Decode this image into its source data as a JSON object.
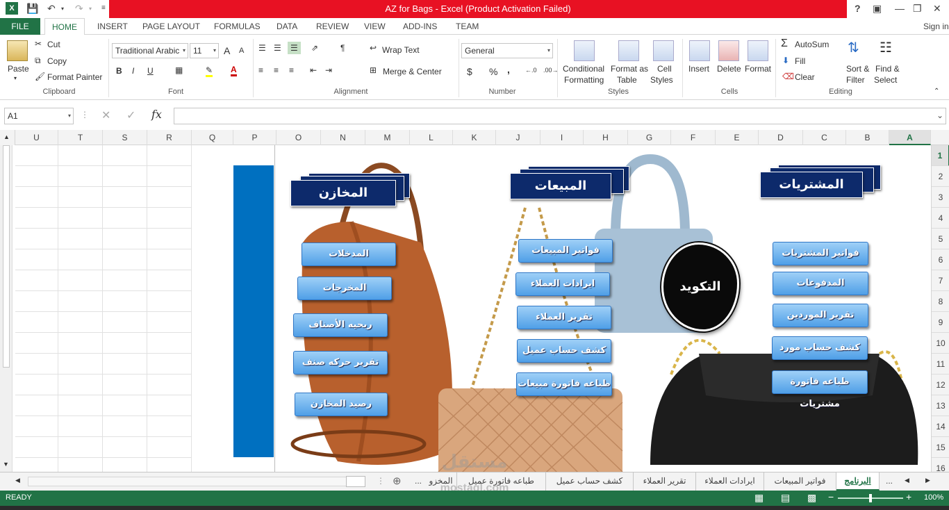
{
  "window": {
    "title": "AZ for Bags -  Excel (Product Activation Failed)",
    "signin": "Sign in"
  },
  "ribbon_tabs": [
    "FILE",
    "HOME",
    "INSERT",
    "PAGE LAYOUT",
    "FORMULAS",
    "DATA",
    "REVIEW",
    "VIEW",
    "ADD-INS",
    "TEAM"
  ],
  "clipboard": {
    "paste": "Paste",
    "cut": "Cut",
    "copy": "Copy",
    "format_painter": "Format Painter",
    "label": "Clipboard"
  },
  "font": {
    "name": "Traditional Arabic",
    "size": "11",
    "label": "Font",
    "bold": "B",
    "italic": "I",
    "underline": "U",
    "grow": "A",
    "shrink": "A"
  },
  "alignment": {
    "wrap": "Wrap Text",
    "merge": "Merge & Center",
    "label": "Alignment"
  },
  "number": {
    "format": "General",
    "label": "Number",
    "currency": "$",
    "percent": "%",
    "comma": "̓"
  },
  "styles": {
    "conditional_1": "Conditional",
    "conditional_2": "Formatting",
    "format_table_1": "Format as",
    "format_table_2": "Table",
    "cell_styles_1": "Cell",
    "cell_styles_2": "Styles",
    "label": "Styles"
  },
  "cells": {
    "insert": "Insert",
    "delete": "Delete",
    "format": "Format",
    "label": "Cells"
  },
  "editing": {
    "autosum": "AutoSum",
    "fill": "Fill",
    "clear": "Clear",
    "sort_1": "Sort &",
    "sort_2": "Filter",
    "find_1": "Find &",
    "find_2": "Select",
    "label": "Editing"
  },
  "formula_bar": {
    "name_box": "A1",
    "fx": "fx",
    "value": ""
  },
  "columns": [
    "U",
    "T",
    "S",
    "R",
    "Q",
    "P",
    "O",
    "N",
    "M",
    "L",
    "K",
    "J",
    "I",
    "H",
    "G",
    "F",
    "E",
    "D",
    "C",
    "B",
    "A"
  ],
  "rows": [
    "1",
    "2",
    "3",
    "4",
    "5",
    "6",
    "7",
    "8",
    "9",
    "10",
    "11",
    "12",
    "13",
    "14",
    "15",
    "16"
  ],
  "dashboard": {
    "warehouses_title": "المخازن",
    "sales_title": "المبيعات",
    "purchases_title": "المشتريات",
    "coding": "التكويد",
    "warehouses": [
      "المدخلات",
      "المخرجات",
      "ربحيه الأصناف",
      "تقرير حركه صنف",
      "رصيد المخازن"
    ],
    "sales": [
      "فواتير المبيعات",
      "ايرادات العملاء",
      "تقرير العملاء",
      "كشف حساب عميل",
      "طباعه فاتورة مبيعات"
    ],
    "purchases": [
      "فواتير المشتريات",
      "المدفوعات",
      "تقرير الموردين",
      "كشف حساب مورد",
      "طباعه فاتورة مشتريات"
    ]
  },
  "sheet_tabs": {
    "ellipsis_left": "...",
    "items": [
      "البرنامج",
      "فواتير المبيعات",
      "ايرادات العملاء",
      "تقرير العملاء",
      "كشف حساب عميل",
      "طباعه فاتورة عميل",
      "المخزو"
    ],
    "ellipsis_right": "..."
  },
  "watermark": {
    "brand": "مستقل",
    "url": "mostaql.com"
  },
  "status": {
    "ready": "READY",
    "zoom": "100%"
  },
  "colors": {
    "excel_green": "#217346",
    "title_red": "#e81123",
    "banner_navy": "#0d2a6b",
    "button_blue": "#4f9fe7"
  }
}
